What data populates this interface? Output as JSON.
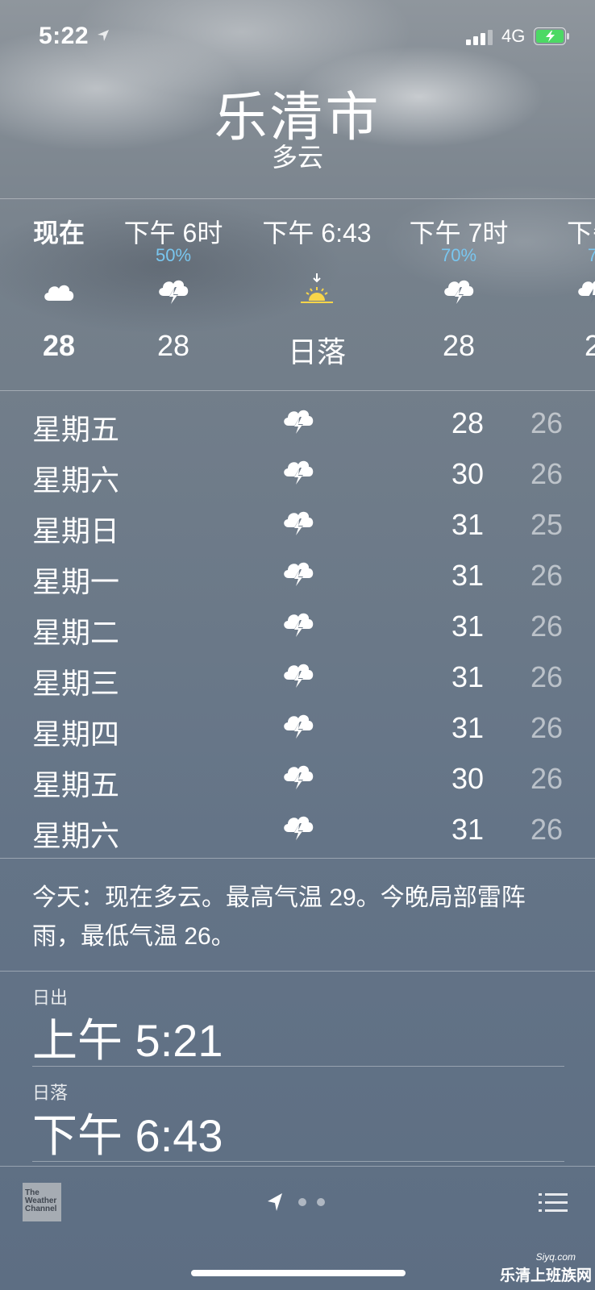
{
  "status": {
    "time": "5:22",
    "network": "4G"
  },
  "header": {
    "city": "乐清市",
    "condition": "多云"
  },
  "hourly": [
    {
      "label": "现在",
      "percent": "",
      "icon": "cloud-icon",
      "temp": "28"
    },
    {
      "label": "下午 6时",
      "percent": "50%",
      "icon": "thunderstorm-icon",
      "temp": "28"
    },
    {
      "label": "下午 6:43",
      "percent": "",
      "icon": "sunset-icon",
      "temp": "日落"
    },
    {
      "label": "下午 7时",
      "percent": "70%",
      "icon": "thunderstorm-icon",
      "temp": "28"
    },
    {
      "label": "下午",
      "percent": "7",
      "icon": "thunderstorm-icon",
      "temp": "2"
    }
  ],
  "daily": [
    {
      "day": "星期五",
      "icon": "thunderstorm-icon",
      "high": "28",
      "low": "26"
    },
    {
      "day": "星期六",
      "icon": "thunderstorm-icon",
      "high": "30",
      "low": "26"
    },
    {
      "day": "星期日",
      "icon": "thunderstorm-icon",
      "high": "31",
      "low": "25"
    },
    {
      "day": "星期一",
      "icon": "thunderstorm-icon",
      "high": "31",
      "low": "26"
    },
    {
      "day": "星期二",
      "icon": "thunderstorm-icon",
      "high": "31",
      "low": "26"
    },
    {
      "day": "星期三",
      "icon": "thunderstorm-icon",
      "high": "31",
      "low": "26"
    },
    {
      "day": "星期四",
      "icon": "thunderstorm-icon",
      "high": "31",
      "low": "26"
    },
    {
      "day": "星期五",
      "icon": "thunderstorm-icon",
      "high": "30",
      "low": "26"
    },
    {
      "day": "星期六",
      "icon": "thunderstorm-icon",
      "high": "31",
      "low": "26"
    }
  ],
  "summary": "今天：现在多云。最高气温 29。今晚局部雷阵雨，最低气温 26。",
  "sunrise": {
    "label": "日出",
    "value": "上午 5:21"
  },
  "sunset": {
    "label": "日落",
    "value": "下午 6:43"
  },
  "footer": {
    "logo_text": "The Weather Channel"
  },
  "watermark": {
    "text": "乐清上班族网",
    "small": "Siyq.com"
  },
  "colors": {
    "precip": "#79c6ef",
    "sun": "#f7d54a",
    "battery": "#4cd964"
  }
}
